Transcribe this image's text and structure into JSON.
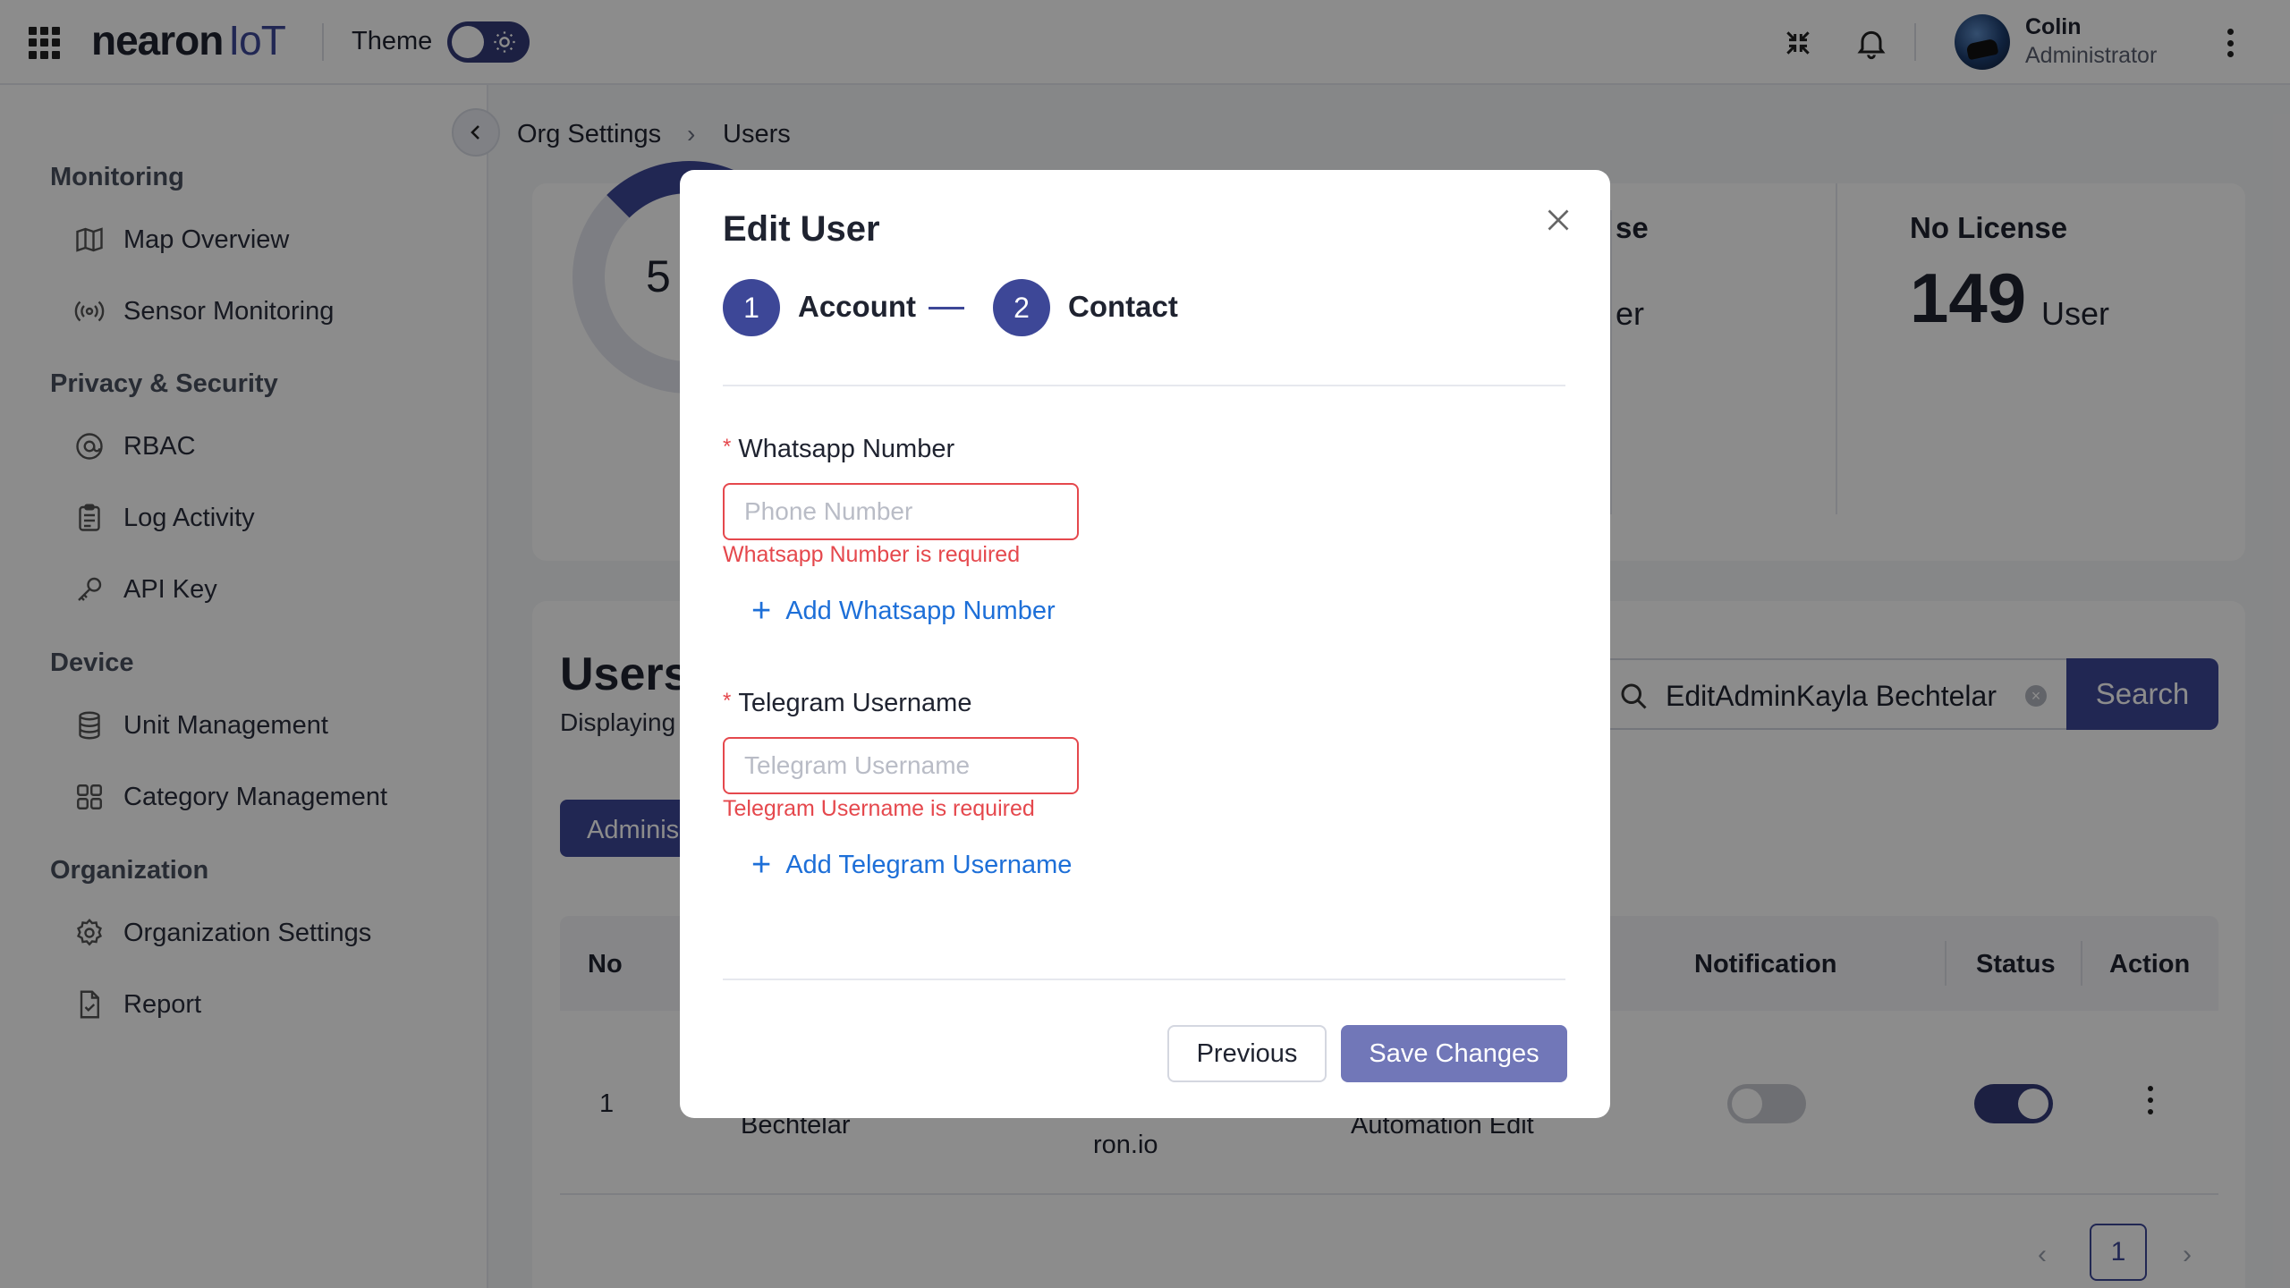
{
  "topbar": {
    "logo_main": "nearon",
    "logo_suffix": "IoT",
    "theme_label": "Theme",
    "user_name": "Colin",
    "user_role": "Administrator"
  },
  "sidebar": {
    "sections": [
      {
        "title": "Monitoring",
        "items": [
          {
            "label": "Map Overview",
            "icon": "map-icon"
          },
          {
            "label": "Sensor Monitoring",
            "icon": "signal-icon"
          }
        ]
      },
      {
        "title": "Privacy & Security",
        "items": [
          {
            "label": "RBAC",
            "icon": "at-icon"
          },
          {
            "label": "Log Activity",
            "icon": "clipboard-icon"
          },
          {
            "label": "API Key",
            "icon": "key-icon"
          }
        ]
      },
      {
        "title": "Device",
        "items": [
          {
            "label": "Unit Management",
            "icon": "database-icon"
          },
          {
            "label": "Category Management",
            "icon": "grid-icon"
          }
        ]
      },
      {
        "title": "Organization",
        "items": [
          {
            "label": "Organization Settings",
            "icon": "gear-icon"
          },
          {
            "label": "Report",
            "icon": "file-check-icon"
          }
        ]
      }
    ]
  },
  "breadcrumb": {
    "parent": "Org Settings",
    "current": "Users"
  },
  "background": {
    "donut_text": "5",
    "stat_partial_label": "se",
    "stat_partial_unit": "er",
    "stat_label": "No License",
    "stat_value": "149",
    "stat_unit": "User",
    "users_title": "Users",
    "users_subtitle": "Displaying",
    "admin_tab": "Adminis",
    "search_value": "EditAdminKayla Bechtelar",
    "search_button": "Search",
    "table_headers": {
      "no": "No",
      "notification": "Notification",
      "status": "Status",
      "action": "Action"
    },
    "row": {
      "no": "1",
      "name_partial": "Bechtelar",
      "email_partial": "ron.io",
      "role_partial": "Automation Edit",
      "notification_on": false,
      "status_on": true
    },
    "pagination_page": "1"
  },
  "modal": {
    "title": "Edit User",
    "steps": [
      {
        "number": "1",
        "label": "Account"
      },
      {
        "number": "2",
        "label": "Contact"
      }
    ],
    "whatsapp": {
      "label": "Whatsapp Number",
      "placeholder": "Phone Number",
      "error": "Whatsapp Number is required",
      "add_label": "Add Whatsapp Number"
    },
    "telegram": {
      "label": "Telegram Username",
      "placeholder": "Telegram Username",
      "error": "Telegram Username is required",
      "add_label": "Add Telegram Username"
    },
    "previous_label": "Previous",
    "save_label": "Save Changes"
  },
  "colors": {
    "primary": "#3d4797",
    "error": "#e5484d",
    "link": "#1d6fd8",
    "save_button": "#7177b8"
  }
}
